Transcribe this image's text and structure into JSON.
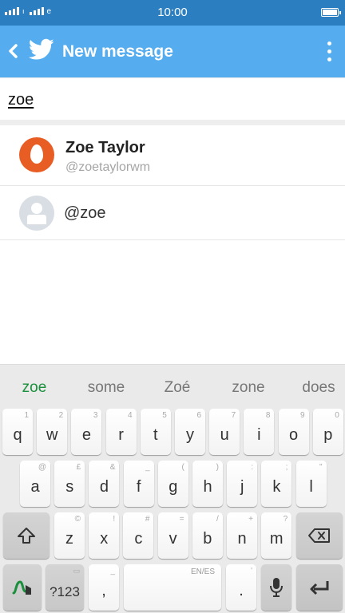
{
  "status_bar": {
    "time": "10:00",
    "network_icon": "signal-icon",
    "battery_icon": "battery-icon"
  },
  "app_bar": {
    "title": "New message",
    "back_icon": "back-icon",
    "logo_icon": "twitter-bird-icon",
    "overflow_icon": "more-vert-icon",
    "color": "#55acee"
  },
  "search": {
    "value": "zoe"
  },
  "results": [
    {
      "name": "Zoe Taylor",
      "handle": "@zoetaylorwm",
      "avatar": "egg-avatar-icon"
    },
    {
      "label": "@zoe",
      "avatar": "default-user-icon"
    }
  ],
  "keyboard": {
    "suggestions": [
      "zoe",
      "some",
      "Zoé",
      "zone",
      "does"
    ],
    "accent_color": "#1a8f3c",
    "row1": [
      {
        "key": "q",
        "hint": "1"
      },
      {
        "key": "w",
        "hint": "2"
      },
      {
        "key": "e",
        "hint": "3"
      },
      {
        "key": "r",
        "hint": "4"
      },
      {
        "key": "t",
        "hint": "5"
      },
      {
        "key": "y",
        "hint": "6"
      },
      {
        "key": "u",
        "hint": "7"
      },
      {
        "key": "i",
        "hint": "8"
      },
      {
        "key": "o",
        "hint": "9"
      },
      {
        "key": "p",
        "hint": "0"
      }
    ],
    "row2": [
      {
        "key": "a",
        "hint": "@"
      },
      {
        "key": "s",
        "hint": "£"
      },
      {
        "key": "d",
        "hint": "&"
      },
      {
        "key": "f",
        "hint": "_"
      },
      {
        "key": "g",
        "hint": "("
      },
      {
        "key": "h",
        "hint": ")"
      },
      {
        "key": "j",
        "hint": ":"
      },
      {
        "key": "k",
        "hint": ";"
      },
      {
        "key": "l",
        "hint": "\""
      }
    ],
    "row3": [
      {
        "key": "z",
        "hint": "©"
      },
      {
        "key": "x",
        "hint": "!"
      },
      {
        "key": "c",
        "hint": "#"
      },
      {
        "key": "v",
        "hint": "="
      },
      {
        "key": "b",
        "hint": "/"
      },
      {
        "key": "n",
        "hint": "+"
      },
      {
        "key": "m",
        "hint": "?"
      }
    ],
    "shift_icon": "shift-icon",
    "backspace_icon": "backspace-icon",
    "swype_icon": "swype-icon",
    "symbols_label": "?123",
    "comma": ",",
    "comma_hint": "_",
    "space_lang": "EN/ES",
    "period": ".",
    "period_hint": "'",
    "mic_icon": "microphone-icon",
    "enter_icon": "enter-icon"
  }
}
